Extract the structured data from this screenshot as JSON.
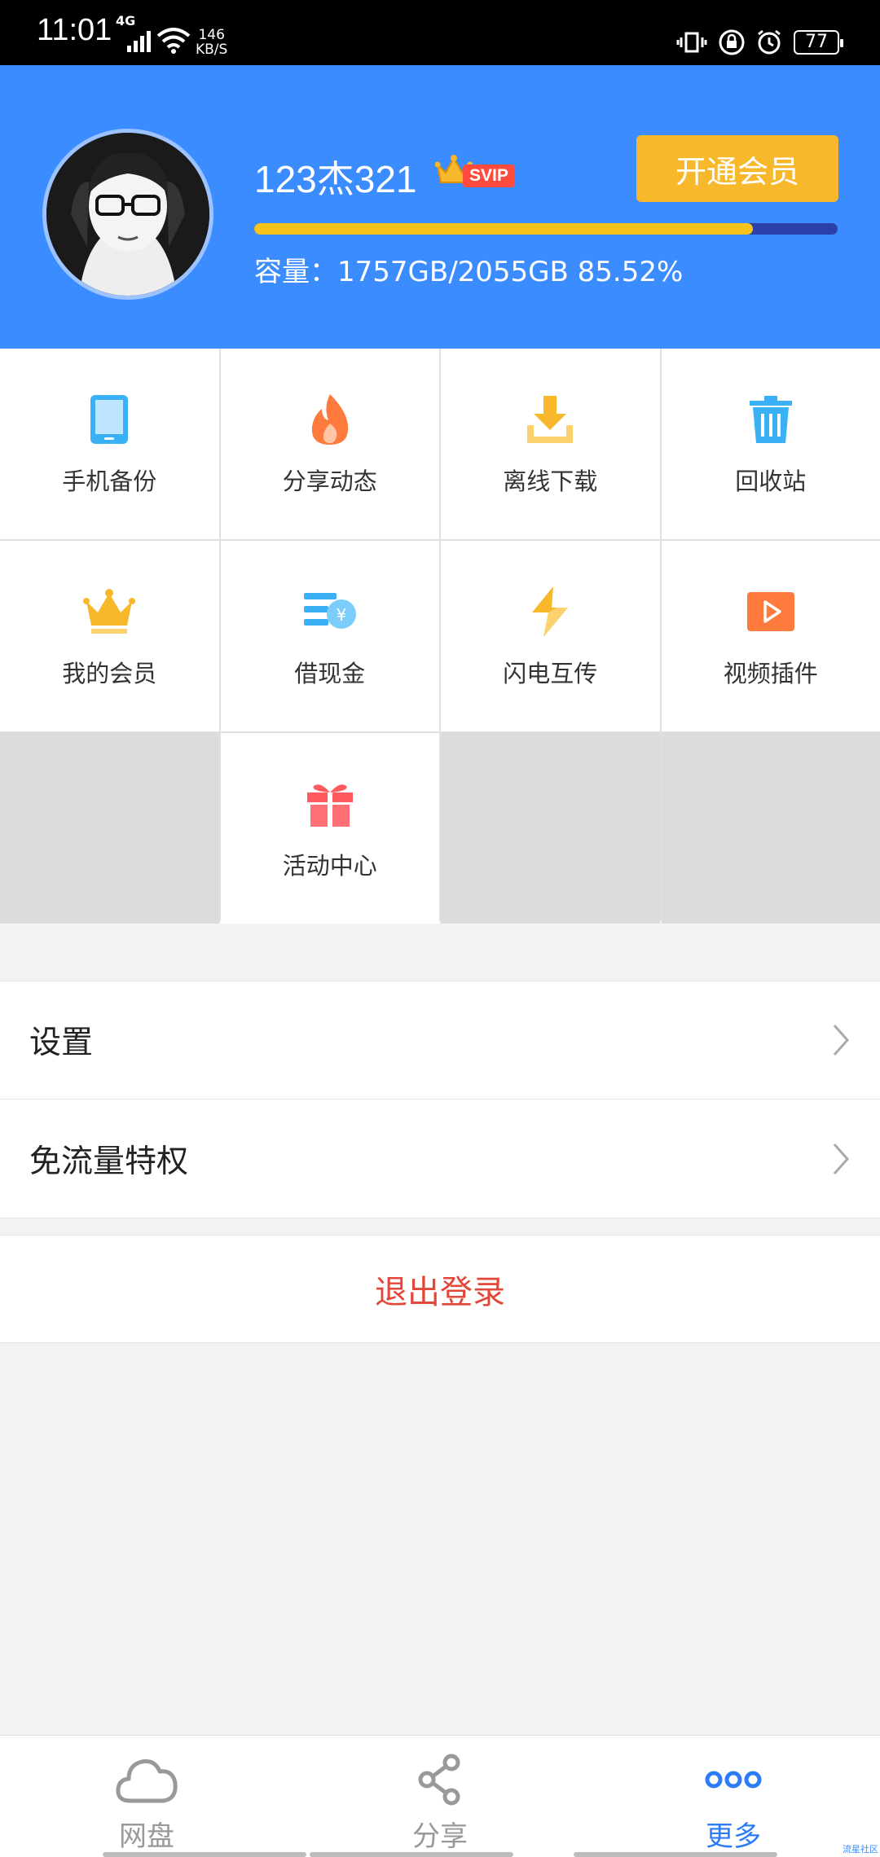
{
  "status_bar": {
    "time": "11:01",
    "network": "4G",
    "speed_value": "146",
    "speed_unit": "KB/S",
    "battery": "77"
  },
  "profile": {
    "username": "123杰321",
    "badge": "SVIP",
    "open_vip_label": "开通会员",
    "capacity_text": "容量：1757GB/2055GB 85.52%",
    "capacity_percent": 85.52
  },
  "grid": [
    {
      "label": "手机备份",
      "icon": "phone-icon"
    },
    {
      "label": "分享动态",
      "icon": "flame-icon"
    },
    {
      "label": "离线下载",
      "icon": "download-icon"
    },
    {
      "label": "回收站",
      "icon": "trash-icon"
    },
    {
      "label": "我的会员",
      "icon": "crown-icon"
    },
    {
      "label": "借现金",
      "icon": "cash-icon"
    },
    {
      "label": "闪电互传",
      "icon": "lightning-icon"
    },
    {
      "label": "视频插件",
      "icon": "video-icon"
    },
    {
      "label": "活动中心",
      "icon": "gift-icon"
    }
  ],
  "menu": [
    {
      "label": "设置"
    },
    {
      "label": "免流量特权"
    }
  ],
  "logout_label": "退出登录",
  "bottom_nav": [
    {
      "label": "网盘",
      "icon": "cloud-icon",
      "active": false
    },
    {
      "label": "分享",
      "icon": "share-icon",
      "active": false
    },
    {
      "label": "更多",
      "icon": "more-icon",
      "active": true
    }
  ],
  "colors": {
    "header": "#3b8cff",
    "accent": "#f8b82c",
    "logout": "#e2483a",
    "active_tab": "#2b7cf6"
  },
  "watermark": "流星社区"
}
